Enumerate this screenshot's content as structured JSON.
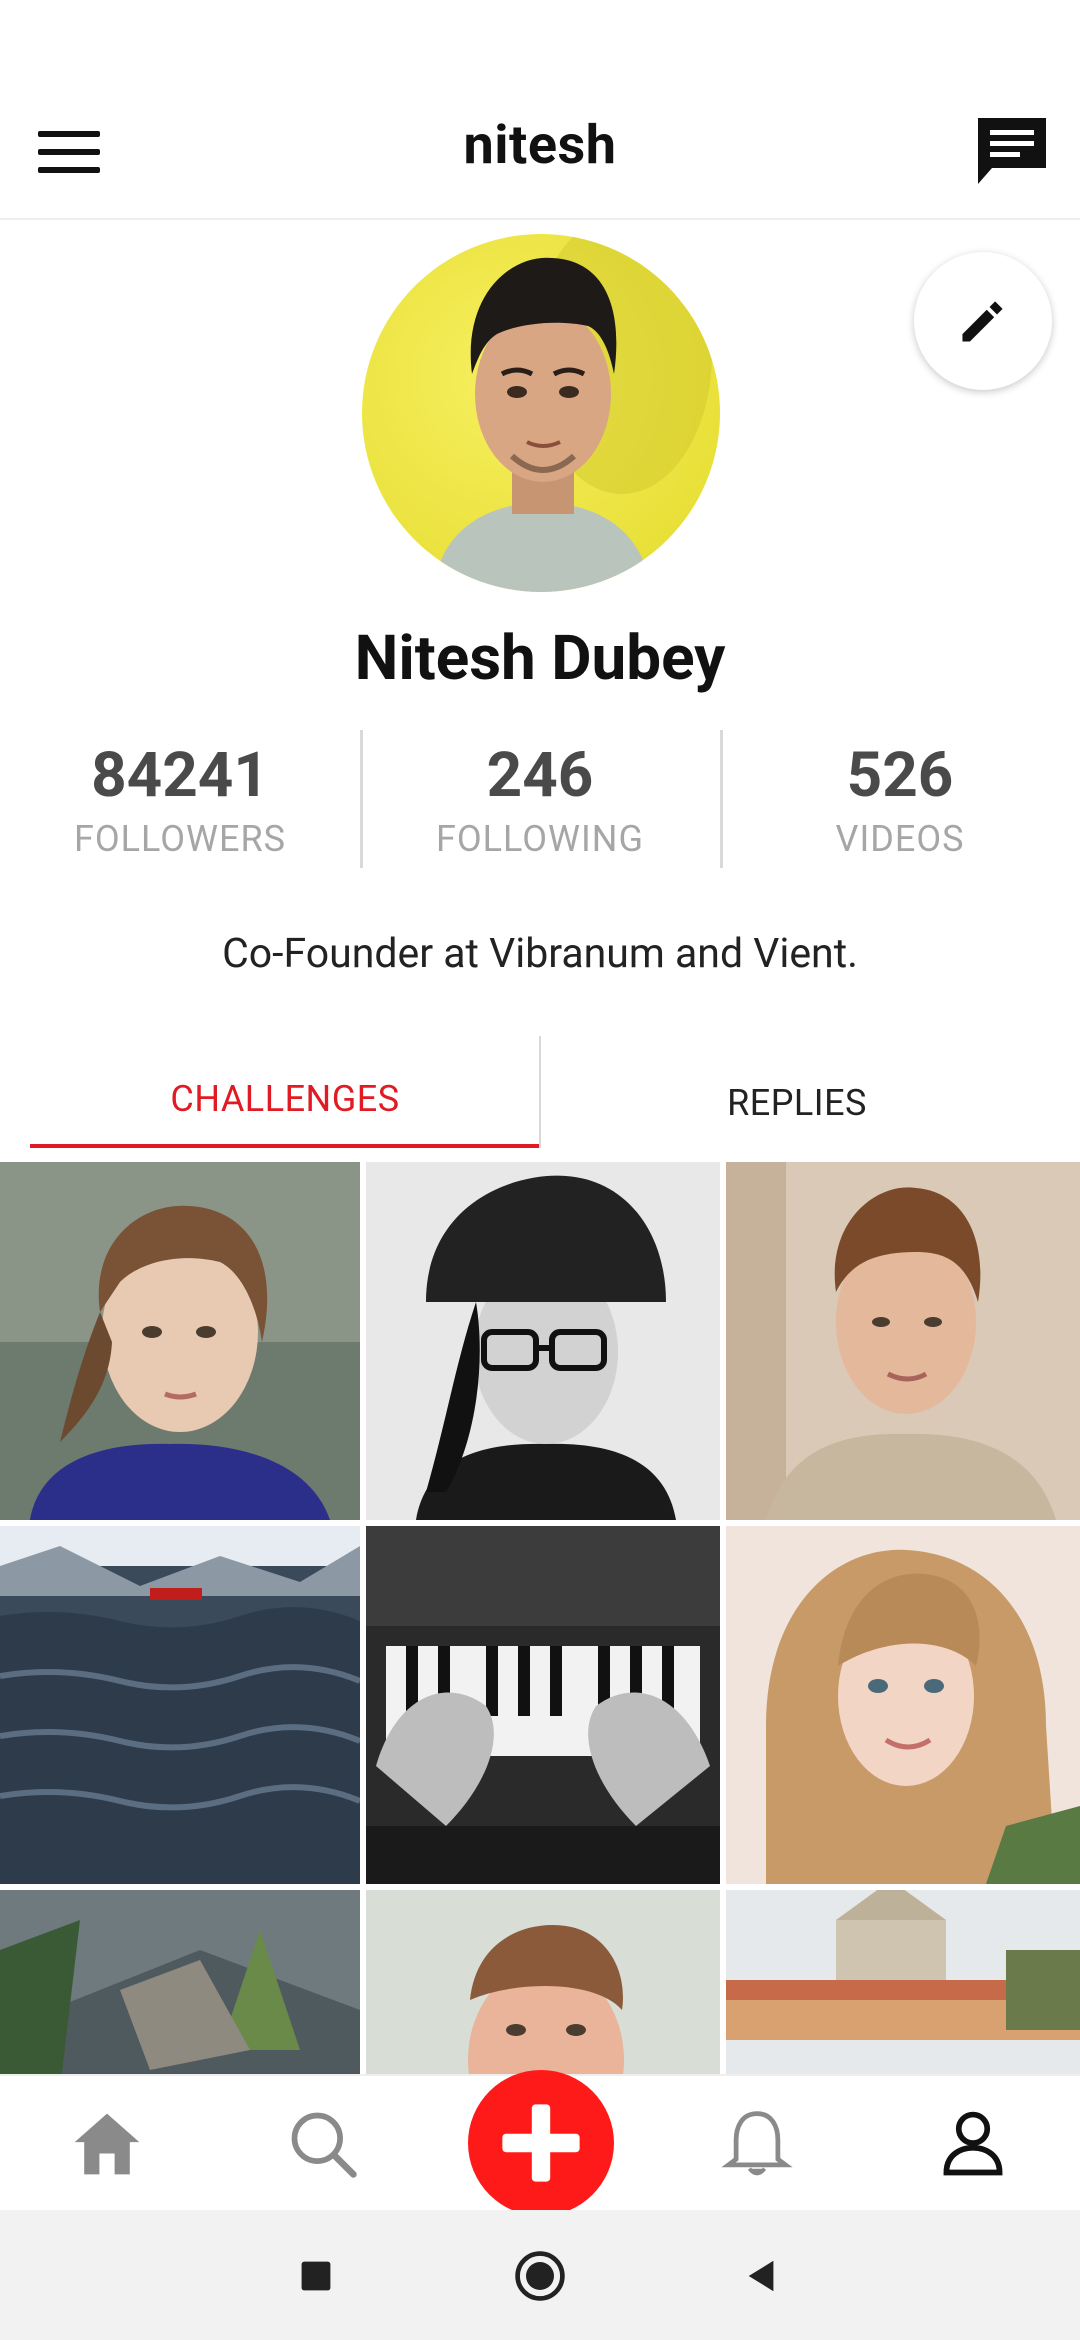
{
  "header": {
    "title": "nitesh",
    "menu_icon": "hamburger-menu-icon",
    "chat_icon": "chat-message-icon"
  },
  "profile": {
    "name": "Nitesh Dubey",
    "bio": "Co-Founder at Vibranum and Vient.",
    "edit_icon": "pencil-edit-icon"
  },
  "stats": [
    {
      "value": "84241",
      "label": "FOLLOWERS"
    },
    {
      "value": "246",
      "label": "FOLLOWING"
    },
    {
      "value": "526",
      "label": "VIDEOS"
    }
  ],
  "tabs": {
    "active": "CHALLENGES",
    "items": [
      {
        "label": "CHALLENGES"
      },
      {
        "label": "REPLIES"
      }
    ]
  },
  "colors": {
    "accent": "#e01b24",
    "fab": "#ff1a1a",
    "stat_number": "#4a4a4a",
    "stat_label": "#a6a6a6"
  },
  "bottom_nav": [
    {
      "icon": "home-icon"
    },
    {
      "icon": "search-icon"
    },
    {
      "icon": "plus-add-icon"
    },
    {
      "icon": "bell-notification-icon"
    },
    {
      "icon": "profile-person-icon"
    }
  ],
  "system_nav": [
    {
      "icon": "square-recents-icon"
    },
    {
      "icon": "circle-home-icon"
    },
    {
      "icon": "triangle-back-icon"
    }
  ]
}
